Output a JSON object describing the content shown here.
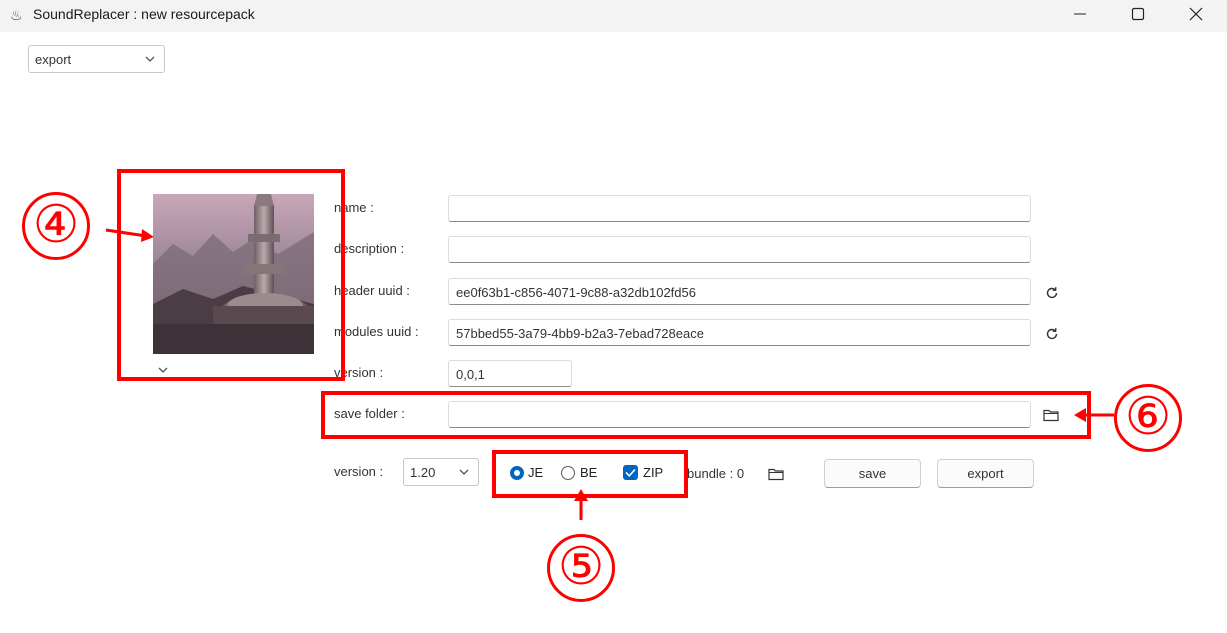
{
  "window": {
    "title": "SoundReplacer :  new resourcepack",
    "app_icon": "java-cup-icon"
  },
  "mode_select": {
    "value": "export"
  },
  "image_toggle": {
    "icon": "chevron-down-icon"
  },
  "form": {
    "name": {
      "label": "name :",
      "value": ""
    },
    "description": {
      "label": "description :",
      "value": ""
    },
    "header_uuid": {
      "label": "header uuid :",
      "value": "ee0f63b1-c856-4071-9c88-a32db102fd56"
    },
    "modules_uuid": {
      "label": "modules uuid :",
      "value": "57bbed55-3a79-4bb9-b2a3-7ebad728eace"
    },
    "version": {
      "label": "version :",
      "value": "0,0,1"
    },
    "save_folder": {
      "label": "save folder :",
      "value": ""
    }
  },
  "bottom": {
    "version_label": "version :",
    "version_value": "1.20",
    "edition": {
      "je_label": "JE",
      "je_selected": true,
      "be_label": "BE",
      "be_selected": false
    },
    "zip": {
      "label": "ZIP",
      "checked": true
    },
    "bundle_label": "bundle : 0",
    "save_button": "save",
    "export_button": "export"
  },
  "annotations": {
    "marker_4": "④",
    "marker_5": "⑤",
    "marker_6": "⑥",
    "color": "#ff0000"
  },
  "colors": {
    "accent": "#0067c0",
    "titlebar": "#f3f3f3",
    "annotation": "#ff0000"
  }
}
